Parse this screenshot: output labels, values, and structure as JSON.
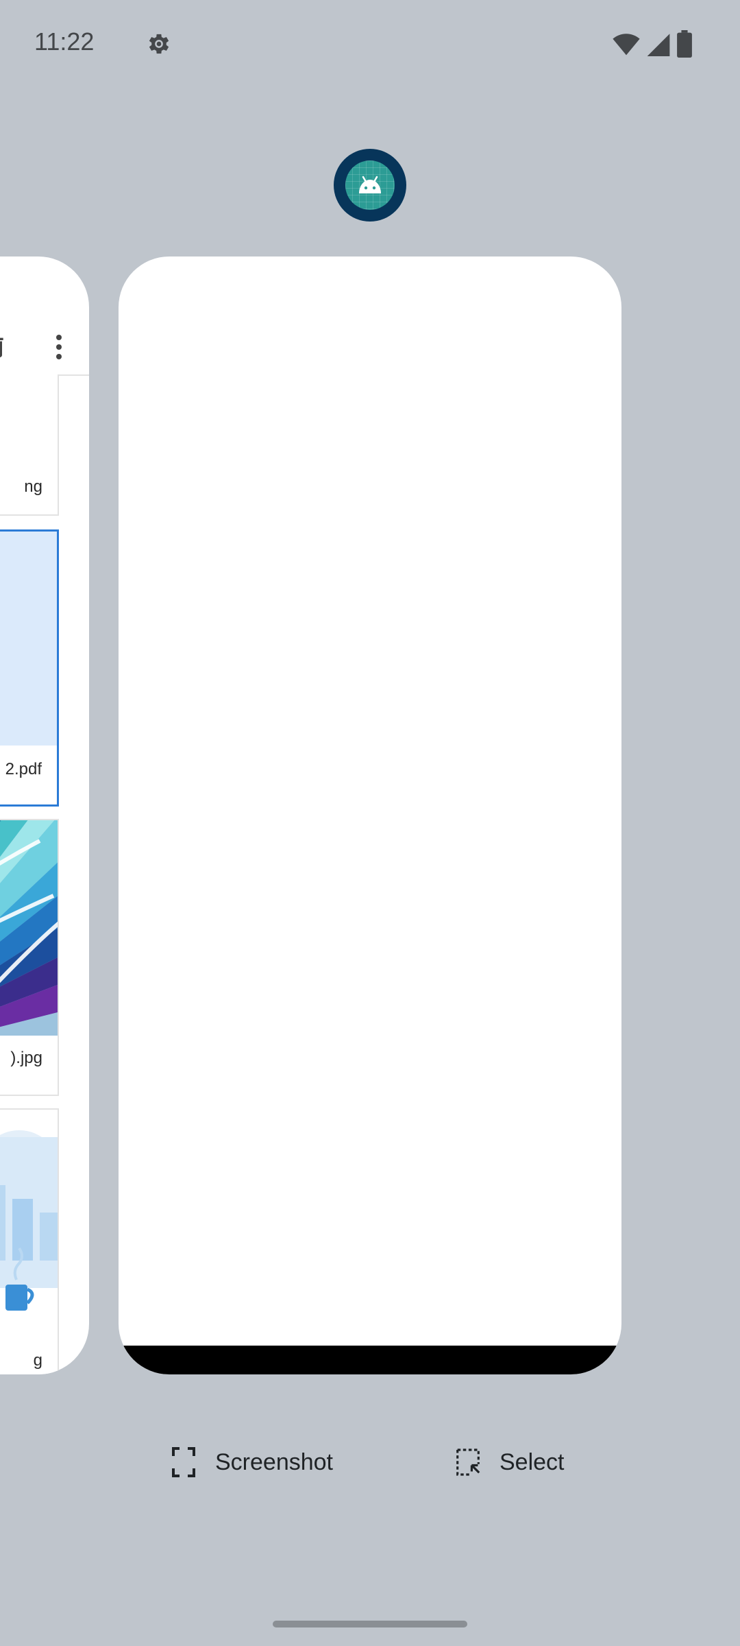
{
  "status_bar": {
    "time": "11:22",
    "icons": [
      "settings-gear-icon",
      "wifi-icon",
      "cellular-signal-icon",
      "battery-icon"
    ]
  },
  "app_icon": {
    "name": "android-app-icon",
    "color_outer": "#07355a",
    "color_inner": "#2c9c95"
  },
  "left_card": {
    "toolbar_icons": [
      "trash-icon",
      "more-vert-icon"
    ],
    "files": [
      {
        "label": "ng",
        "selected": false
      },
      {
        "label": "2.pdf",
        "selected": true
      },
      {
        "label": ").jpg",
        "selected": false
      },
      {
        "label": "g",
        "selected": false
      }
    ]
  },
  "actions": {
    "screenshot_label": "Screenshot",
    "select_label": "Select"
  },
  "colors": {
    "background": "#bfc5cc",
    "selected_border": "#2b7bd6",
    "pdf_thumb": "#dbeafb"
  }
}
